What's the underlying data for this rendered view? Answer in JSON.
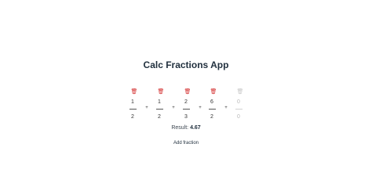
{
  "app": {
    "title": "Calc Fractions App"
  },
  "fractions": [
    {
      "numerator": "1",
      "denominator": "2"
    },
    {
      "numerator": "1",
      "denominator": "2"
    },
    {
      "numerator": "2",
      "denominator": "3"
    },
    {
      "numerator": "6",
      "denominator": "2"
    },
    {
      "numerator": "0",
      "denominator": "0"
    }
  ],
  "operators": [
    "+",
    "+",
    "+",
    "+"
  ],
  "icons": {
    "delete": "trash-icon"
  },
  "colors": {
    "delete_icon": "#d22a2a",
    "title": "#22313f"
  },
  "result": {
    "label": "Result:",
    "value": "4.67"
  },
  "actions": {
    "add_fraction_label": "Add fraction"
  }
}
